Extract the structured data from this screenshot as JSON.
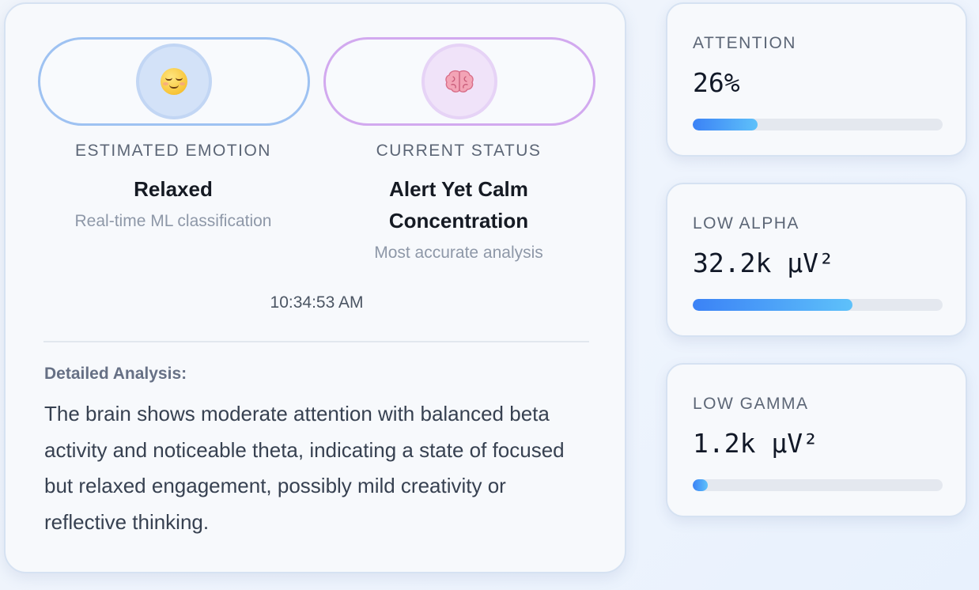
{
  "emotion": {
    "label": "ESTIMATED EMOTION",
    "value": "Relaxed",
    "subtitle": "Real-time ML classification",
    "icon": "relieved-face-icon"
  },
  "status": {
    "label": "CURRENT STATUS",
    "value_line1": "Alert Yet Calm",
    "value_line2": "Concentration",
    "subtitle": "Most accurate analysis",
    "icon": "brain-icon"
  },
  "timestamp": "10:34:53 AM",
  "analysis": {
    "title": "Detailed Analysis:",
    "text": "The brain shows moderate attention with balanced beta activity and noticeable theta, indicating a state of focused but relaxed engagement, possibly mild creativity or reflective thinking."
  },
  "metrics": [
    {
      "label": "ATTENTION",
      "value": "26%",
      "level": 0.26
    },
    {
      "label": "LOW ALPHA",
      "value": "32.2k µV²",
      "level": 0.64
    },
    {
      "label": "LOW GAMMA",
      "value": "1.2k µV²",
      "level": 0.06
    }
  ],
  "colors": {
    "emotion_accent": "#9ec2f2",
    "status_accent": "#d2a9ef",
    "bar_start": "#3b82f6",
    "bar_end": "#5ec1fa"
  }
}
